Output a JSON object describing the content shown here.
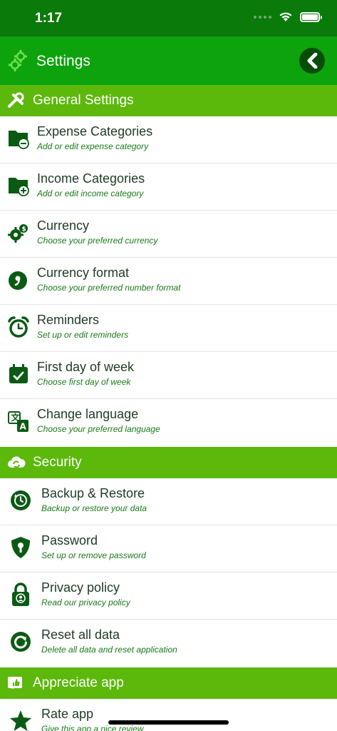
{
  "status": {
    "time": "1:17"
  },
  "header": {
    "title": "Settings"
  },
  "sections": {
    "general": "General Settings",
    "security": "Security",
    "appreciate": "Appreciate app"
  },
  "general_items": [
    {
      "title": "Expense Categories",
      "subtitle": "Add or edit expense category"
    },
    {
      "title": "Income Categories",
      "subtitle": "Add or edit income category"
    },
    {
      "title": "Currency",
      "subtitle": "Choose your preferred currency"
    },
    {
      "title": "Currency format",
      "subtitle": "Choose your preferred number format"
    },
    {
      "title": "Reminders",
      "subtitle": "Set up or edit reminders"
    },
    {
      "title": "First day of week",
      "subtitle": "Choose first day of week"
    },
    {
      "title": "Change language",
      "subtitle": "Choose your preferred language"
    }
  ],
  "security_items": [
    {
      "title": "Backup & Restore",
      "subtitle": "Backup or restore your data"
    },
    {
      "title": "Password",
      "subtitle": "Set up or remove password"
    },
    {
      "title": "Privacy policy",
      "subtitle": "Read our privacy policy"
    },
    {
      "title": "Reset all data",
      "subtitle": "Delete all data and reset application"
    }
  ],
  "appreciate_items": [
    {
      "title": "Rate app",
      "subtitle": "Give this app a nice review"
    }
  ],
  "colors": {
    "status_bar": "#0a7a0a",
    "app_bar": "#0ca30c",
    "section_header": "#5cb80b",
    "icon_dark_green": "#0b5a14",
    "subtitle_green": "#1a7a1a"
  }
}
